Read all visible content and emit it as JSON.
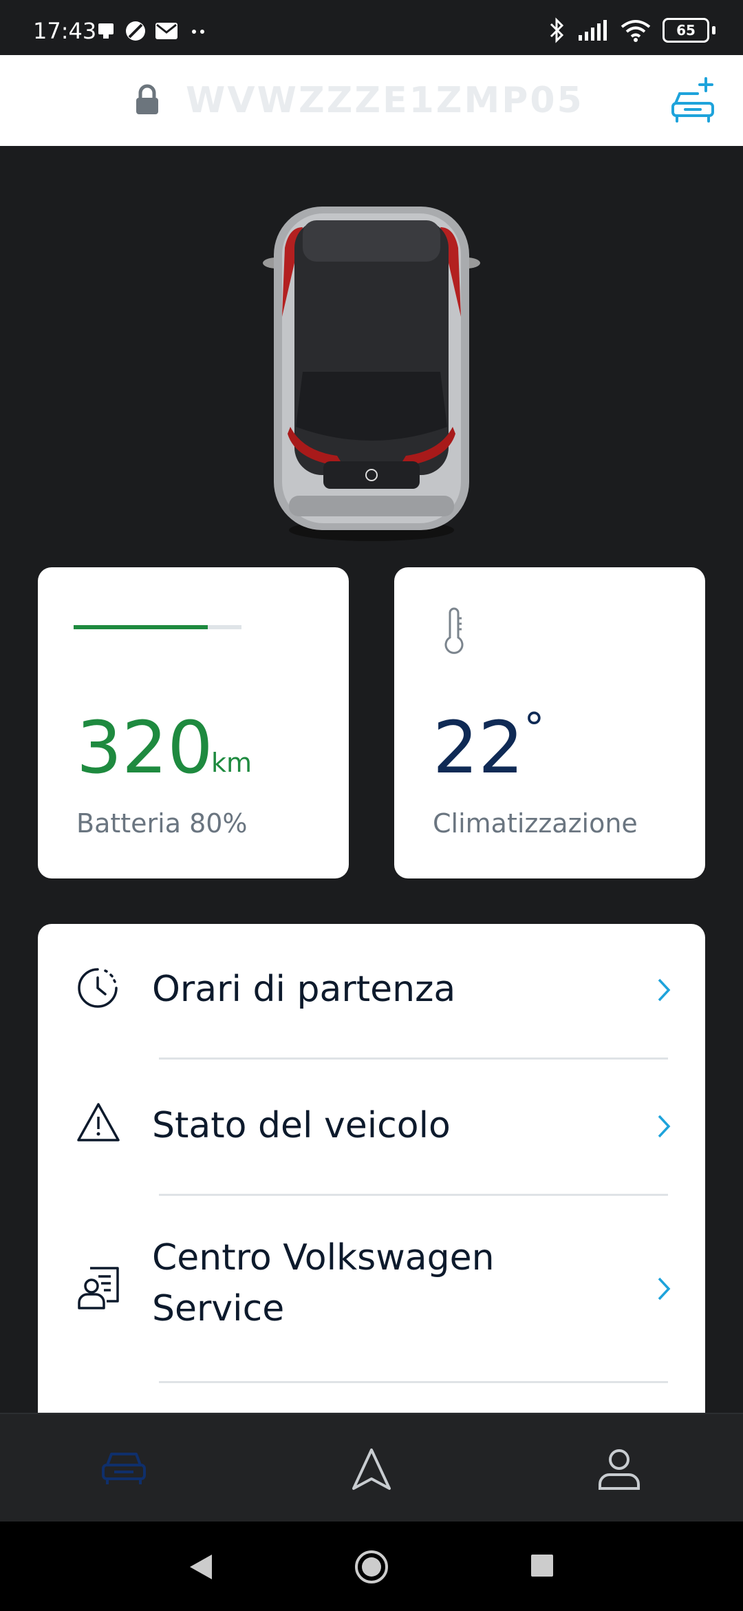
{
  "status_bar": {
    "time": "17:43",
    "left_icons": [
      "notification-icon",
      "vpn-icon",
      "mail-icon",
      "more-dots-icon"
    ],
    "right_icons": [
      "bluetooth-icon",
      "signal-icon",
      "wifi-icon"
    ],
    "battery_level": "65"
  },
  "header": {
    "vehicle_id": "WVWZZZE1ZMP05",
    "lock_icon": "lock-icon",
    "add_vehicle_icon": "add-car-icon",
    "accent_color": "#1ea3db"
  },
  "tiles": {
    "battery": {
      "range_value": "320",
      "range_unit": "km",
      "label": "Batteria 80%",
      "charge_fraction": 0.8,
      "color": "#1e8a3f"
    },
    "climate": {
      "temperature": "22",
      "degree_symbol": "°",
      "label": "Climatizzazione",
      "color": "#0f2a55"
    }
  },
  "menu": [
    {
      "label": "Orari di partenza",
      "icon": "clock-icon"
    },
    {
      "label": "Stato del veicolo",
      "icon": "warning-icon"
    },
    {
      "label_line1": "Centro Volkswagen",
      "label_line2": "Service",
      "icon": "service-center-icon"
    }
  ],
  "bottom_nav": {
    "items": [
      {
        "icon": "car-icon",
        "active": true
      },
      {
        "icon": "navigation-icon",
        "active": false
      },
      {
        "icon": "profile-icon",
        "active": false
      }
    ]
  },
  "system_nav": [
    "back-icon",
    "home-icon",
    "recents-icon"
  ]
}
